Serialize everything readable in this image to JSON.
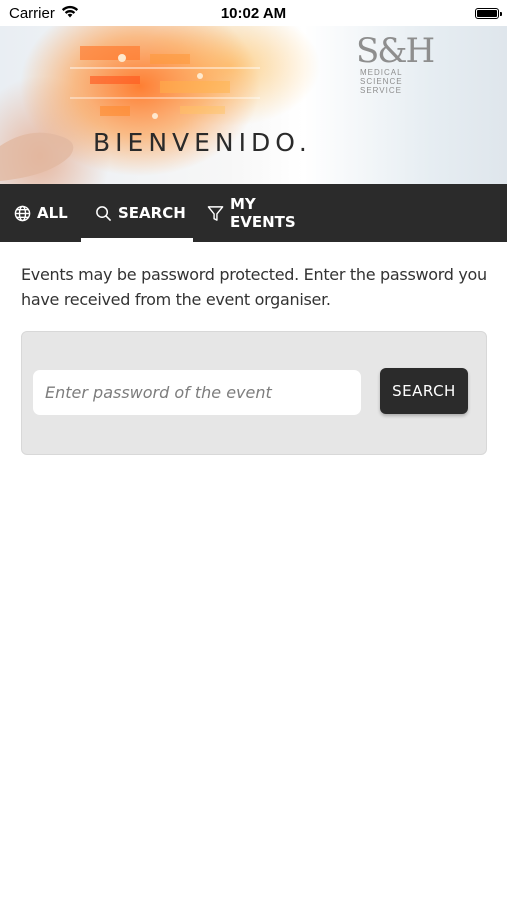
{
  "status_bar": {
    "carrier": "Carrier",
    "time": "10:02 AM",
    "wifi_icon": "wifi-icon",
    "battery_icon": "battery-icon"
  },
  "banner": {
    "title": "BIENVENIDO.",
    "logo_mark": "S&H",
    "logo_lines": [
      "MEDICAL",
      "SCIENCE",
      "SERVICE"
    ]
  },
  "tabs": [
    {
      "label": "ALL",
      "icon": "globe-icon",
      "active": false
    },
    {
      "label": "SEARCH",
      "icon": "search-icon",
      "active": true
    },
    {
      "label": "MY EVENTS",
      "icon": "filter-icon",
      "active": false
    }
  ],
  "main": {
    "description": "Events may be password protected. Enter the password you have received from the event organiser.",
    "password_input": {
      "value": "",
      "placeholder": "Enter password of the event"
    },
    "search_button_label": "SEARCH"
  },
  "colors": {
    "tab_bar_bg": "#2b2b2b",
    "button_bg": "#2b2b2b",
    "panel_bg": "#e6e6e6"
  }
}
